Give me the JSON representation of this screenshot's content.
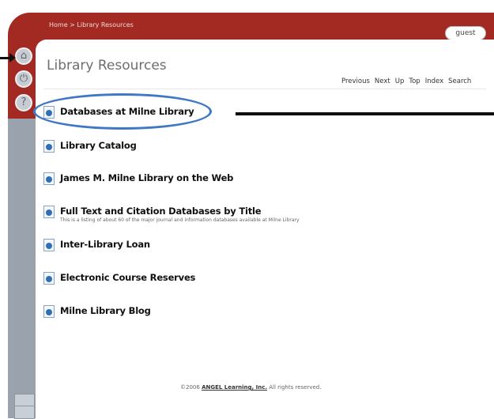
{
  "header": {
    "breadcrumb": "Home > Library Resources",
    "user_button": "guest"
  },
  "sidebar": {
    "icons": [
      "home-icon",
      "power-icon",
      "help-icon"
    ],
    "help_glyph": "?"
  },
  "page": {
    "title": "Library Resources",
    "nav": [
      "Previous",
      "Next",
      "Up",
      "Top",
      "Index",
      "Search"
    ]
  },
  "items": [
    {
      "label": "Databases at Milne Library"
    },
    {
      "label": "Library Catalog"
    },
    {
      "label": "James M. Milne Library on the Web"
    },
    {
      "label": "Full Text and Citation Databases by Title",
      "description": "This is a listing of about 60 of the major journal and information databases available at Milne Library"
    },
    {
      "label": "Inter-Library Loan"
    },
    {
      "label": "Electronic Course Reserves"
    },
    {
      "label": "Milne Library Blog"
    }
  ],
  "footer": {
    "prefix": "©2006",
    "link": "ANGEL Learning, Inc.",
    "suffix": "All rights reserved."
  },
  "colors": {
    "frame": "#a32a22",
    "annotation_circle": "#3f78c4",
    "doc_icon": "#2f6fb8"
  }
}
